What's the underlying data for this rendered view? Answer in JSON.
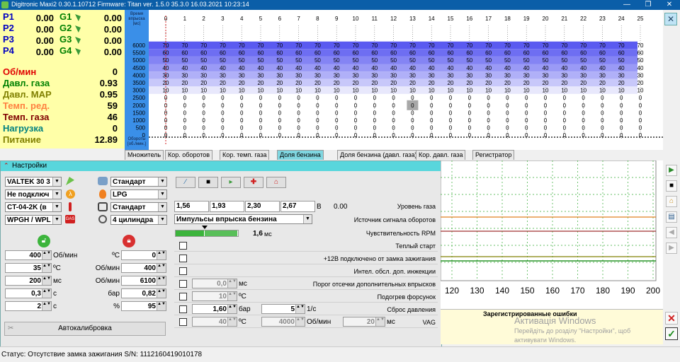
{
  "window": {
    "title": "Digitronic Maxi2 0.30.1.10712 Firmware: Titan  ver. 1.5.0  35.3.0   16.03.2021 10:23:14"
  },
  "sensors": {
    "p": [
      {
        "label": "P1",
        "value": "0.00",
        "g": "G1",
        "gval": "0.00"
      },
      {
        "label": "P2",
        "value": "0.00",
        "g": "G2",
        "gval": "0.00"
      },
      {
        "label": "P3",
        "value": "0.00",
        "g": "G3",
        "gval": "0.00"
      },
      {
        "label": "P4",
        "value": "0.00",
        "g": "G4",
        "gval": "0.00"
      }
    ],
    "params": [
      {
        "label": "Об/мин",
        "value": "0",
        "color": "#e00000"
      },
      {
        "label": "Давл. газа",
        "value": "0.93",
        "color": "#008000"
      },
      {
        "label": "Давл. MAP",
        "value": "0.95",
        "color": "#808000"
      },
      {
        "label": "Темп. ред.",
        "value": "59",
        "color": "#ff8040"
      },
      {
        "label": "Темп. газа",
        "value": "46",
        "color": "#800000"
      },
      {
        "label": "Нагрузка",
        "value": "0",
        "color": "#008080"
      },
      {
        "label": "Питание",
        "value": "12.89",
        "color": "#808000"
      }
    ]
  },
  "grid": {
    "corner_top": "Время\nвпрыска\n[мс]",
    "corner_bottom": "Обороты\n[об./мин.]",
    "columns": [
      "0",
      "1",
      "2",
      "3",
      "4",
      "5",
      "6",
      "7",
      "8",
      "9",
      "10",
      "11",
      "12",
      "13",
      "14",
      "15",
      "16",
      "17",
      "18",
      "19",
      "20",
      "21",
      "22",
      "23",
      "24",
      "25"
    ],
    "rows": [
      "6000",
      "5500",
      "5000",
      "4500",
      "4000",
      "3500",
      "3000",
      "2500",
      "2000",
      "1500",
      "1000",
      "500",
      "0"
    ],
    "row_values": [
      "70",
      "60",
      "50",
      "40",
      "30",
      "20",
      "10",
      "0",
      "0",
      "0",
      "0",
      "0",
      "0"
    ],
    "highlight_cell_value": "0"
  },
  "tabs": [
    "Множитель",
    "Кор. оборотов",
    "Кор. темп. газа",
    "Доля бензина",
    "Доля бензина (давл. газа)",
    "Кор. давл. газа",
    "Регистратор"
  ],
  "active_tab": "Доля бензина",
  "settings": {
    "title": "Настройки",
    "left_selects": [
      "VALTEK 30 3",
      "Не подключ",
      "CT-04-2K (в",
      "WPGH / WPL"
    ],
    "right_selects": [
      "Стандарт",
      "LPG",
      "Стандарт",
      "4 цилиндра"
    ],
    "left_spinners": [
      {
        "value": "400",
        "unit": "Об/мин"
      },
      {
        "value": "35",
        "unit": "ºC"
      },
      {
        "value": "200",
        "unit": "мс"
      },
      {
        "value": "0,3",
        "unit": "c"
      },
      {
        "value": "2",
        "unit": "c"
      }
    ],
    "right_spinners": [
      {
        "unit": "ºC",
        "value": "0"
      },
      {
        "unit": "Об/мин",
        "value": "400"
      },
      {
        "unit": "Об/мин",
        "value": "6100"
      },
      {
        "unit": "бар",
        "value": "0,82"
      },
      {
        "unit": "%",
        "value": "95"
      }
    ],
    "autocal_label": "Автокалибровка",
    "levels": [
      "1,56",
      "1,93",
      "2,30",
      "2,67"
    ],
    "level_unit": "В",
    "level_value": "0.00",
    "level_label": "Уровень газа",
    "rpm_source_select": "Импульсы впрыска бензина",
    "rpm_source_label": "Источник сигнала оборотов",
    "rpm_sens_value": "1,6",
    "rpm_sens_unit": "мс",
    "rpm_sens_label": "Чувствительность RPM",
    "rows": [
      {
        "label": "Теплый старт"
      },
      {
        "label": "+12В подключено от замка зажигания"
      },
      {
        "label": "Интел. обсл. доп. инжекции"
      },
      {
        "label": "Порог отсечки дополнительных впрысков",
        "v1": "0,0",
        "u1": "мс"
      },
      {
        "label": "Подогрев форсунок",
        "v1": "10",
        "u1": "ºC"
      },
      {
        "label": "Сброс давления",
        "v1": "1,60",
        "u1": "бар",
        "v2": "5",
        "u2": "1/с"
      },
      {
        "label": "VAG",
        "v1": "40",
        "u1": "ºC",
        "v2": "4000",
        "u2": "Об/мин",
        "v3": "20",
        "u3": "мс"
      }
    ]
  },
  "graph": {
    "x_ticks": [
      "120",
      "130",
      "140",
      "150",
      "160",
      "170",
      "180",
      "190",
      "200"
    ],
    "errors_title": "Зарегистрированные ошибки",
    "watermark_title": "Активація Windows",
    "watermark_body": "Перейдіть до розділу \"Настройки\", щоб активувати Windows."
  },
  "status": {
    "text": "Статус: Отсутствие замка зажигания S/N: 1112160419010178"
  },
  "colors": {
    "titlebar": "#0b5ea8",
    "sensors_bg": "#ffffa8",
    "settings_head": "#58d6dc",
    "p_label": "#0000c0",
    "g_label": "#008000"
  }
}
